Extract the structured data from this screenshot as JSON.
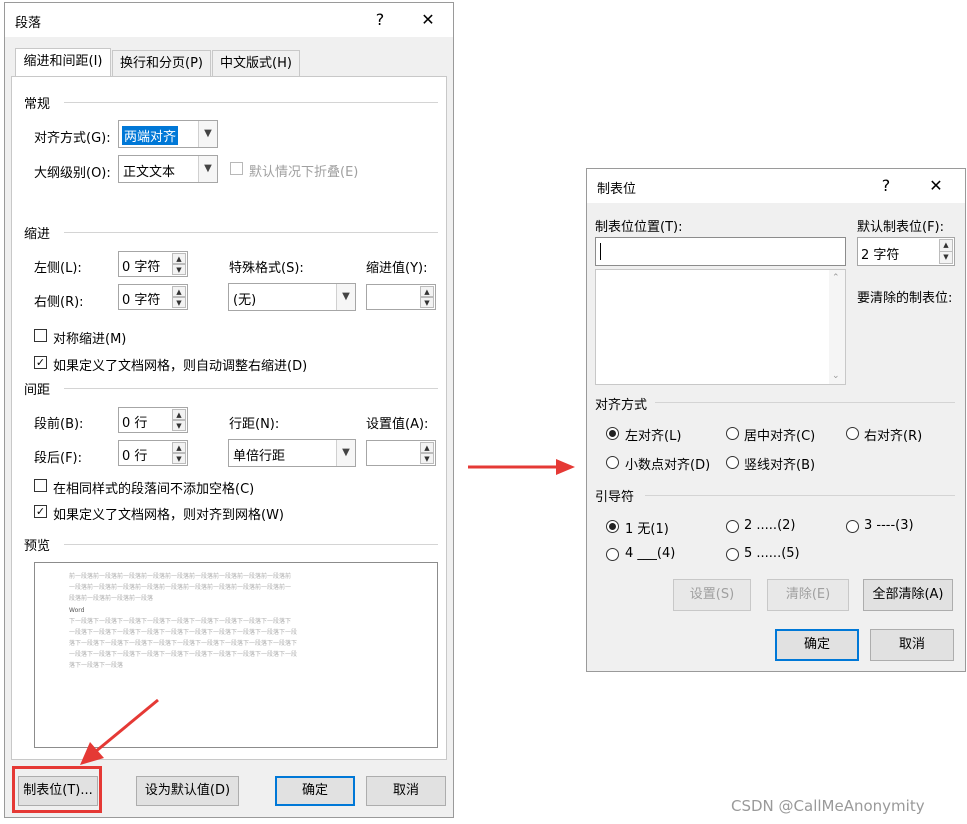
{
  "para": {
    "title": "段落",
    "help": "?",
    "close": "✕",
    "tabs": [
      "缩进和间距(I)",
      "换行和分页(P)",
      "中文版式(H)"
    ],
    "general": {
      "section": "常规",
      "align_label": "对齐方式(G):",
      "align_value": "两端对齐",
      "outline_label": "大纲级别(O):",
      "outline_value": "正文文本",
      "collapse_label": "默认情况下折叠(E)"
    },
    "indent": {
      "section": "缩进",
      "left_label": "左侧(L):",
      "left_value": "0 字符",
      "right_label": "右侧(R):",
      "right_value": "0 字符",
      "special_label": "特殊格式(S):",
      "special_value": "(无)",
      "by_label": "缩进值(Y):",
      "mirror_label": "对称缩进(M)",
      "auto_right_label": "如果定义了文档网格，则自动调整右缩进(D)"
    },
    "spacing": {
      "section": "间距",
      "before_label": "段前(B):",
      "before_value": "0 行",
      "after_label": "段后(F):",
      "after_value": "0 行",
      "line_label": "行距(N):",
      "line_value": "单倍行距",
      "at_label": "设置值(A):",
      "no_space_label": "在相同样式的段落间不添加空格(C)",
      "snap_label": "如果定义了文档网格，则对齐到网格(W)"
    },
    "preview": {
      "section": "预览",
      "prev_lines": [
        "前一段落前一段落前一段落前一段落前一段落前一段落前一段落前一段落前一段落前",
        "一段落前一段落前一段落前一段落前一段落前一段落前一段落前一段落前一段落前一",
        "段落前一段落前一段落前一段落"
      ],
      "sample": "Word",
      "next_lines": [
        "下一段落下一段落下一段落下一段落下一段落下一段落下一段落下一段落下一段落下",
        "一段落下一段落下一段落下一段落下一段落下一段落下一段落下一段落下一段落下一段",
        "落下一段落下一段落下一段落下一段落下一段落下一段落下一段落下一段落下一段落下",
        "一段落下一段落下一段落下一段落下一段落下一段落下一段落下一段落下一段落下一段",
        "落下一段落下一段落"
      ]
    },
    "buttons": {
      "tabs": "制表位(T)...",
      "set_default": "设为默认值(D)",
      "ok": "确定",
      "cancel": "取消"
    }
  },
  "tabsdlg": {
    "title": "制表位",
    "help": "?",
    "close": "✕",
    "pos_label": "制表位位置(T):",
    "default_label": "默认制表位(F):",
    "default_value": "2 字符",
    "clear_label": "要清除的制表位:",
    "align_section": "对齐方式",
    "align_options": [
      "左对齐(L)",
      "居中对齐(C)",
      "右对齐(R)",
      "小数点对齐(D)",
      "竖线对齐(B)"
    ],
    "leader_section": "引导符",
    "leader_options": [
      "1 无(1)",
      "2 .....(2)",
      "3 ----(3)",
      "4 ___(4)",
      "5 ......(5)"
    ],
    "buttons": {
      "set": "设置(S)",
      "clear": "清除(E)",
      "clear_all": "全部清除(A)",
      "ok": "确定",
      "cancel": "取消"
    }
  },
  "watermark": "CSDN @CallMeAnonymity",
  "colors": {
    "accent": "#0078d7",
    "highlight_red": "#e53935",
    "selection": "#0078d7"
  }
}
